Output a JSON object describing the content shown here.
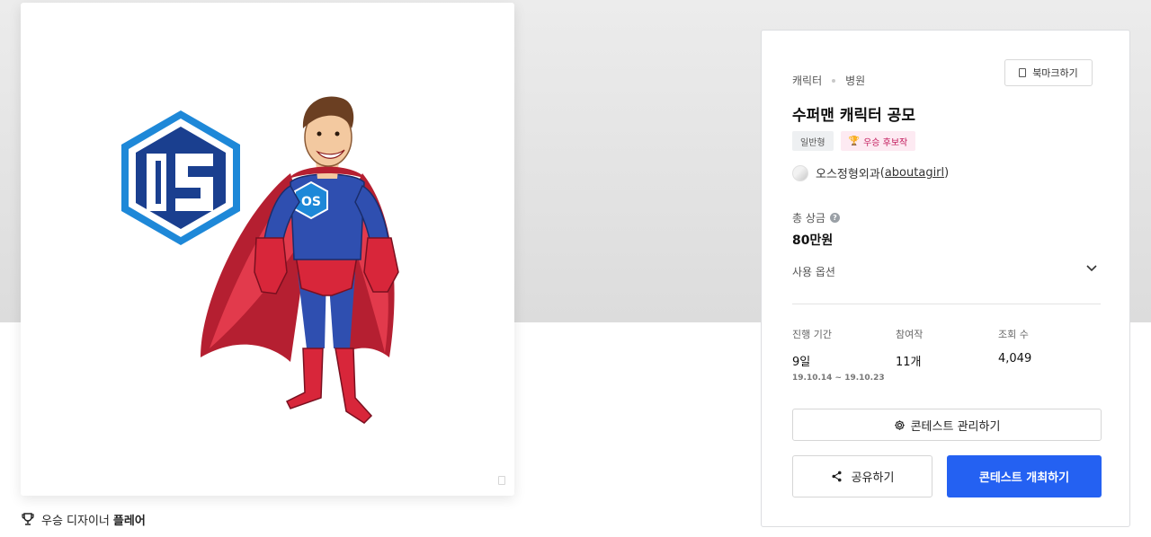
{
  "artwork": {
    "logo_text": "OS",
    "chest_text": "OS"
  },
  "winner": {
    "prefix": "우승 디자이너",
    "name": "플레어",
    "icon": "trophy-icon"
  },
  "contest": {
    "category": "캐릭터",
    "subcategory": "병원",
    "bookmark_label": "북마크하기",
    "title": "수퍼맨 캐릭터 공모",
    "badges": [
      "일반형",
      "우승 후보작"
    ],
    "host_name": "오스정형외과",
    "host_handle": "aboutagirl",
    "prize_label": "총 상금",
    "prize_value": "80만원",
    "usage_label": "사용 옵션",
    "stats": {
      "period_label": "진행 기간",
      "period_value": "9일",
      "period_range": "19.10.14  ~  19.10.23",
      "entries_label": "참여작",
      "entries_value": "11개",
      "views_label": "조회 수",
      "views_value": "4,049"
    },
    "manage_label": "콘테스트 관리하기",
    "share_label": "공유하기",
    "host_label": "콘테스트 개최하기"
  },
  "colors": {
    "primary": "#2461f2",
    "hex_blue": "#1e5bb8",
    "suit_blue": "#2f4fb0",
    "cape_red": "#d8263a"
  }
}
